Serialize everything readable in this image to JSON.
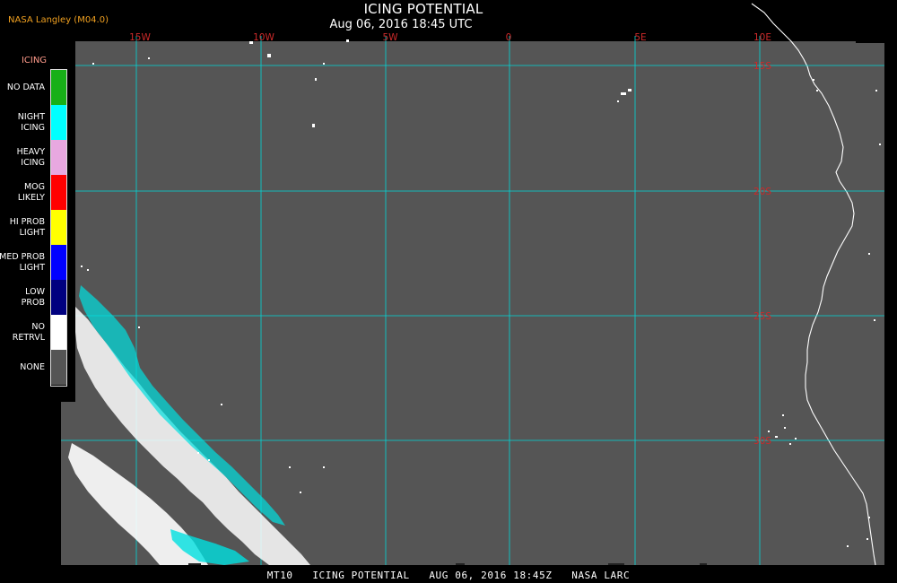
{
  "header": {
    "title": "ICING POTENTIAL",
    "datetime": "Aug 06, 2016 18:45 UTC",
    "provider": "NASA Langley (M04.0)"
  },
  "legend": {
    "title": "ICING",
    "items": [
      {
        "label": "NO DATA",
        "color": "#17b017"
      },
      {
        "label": "NIGHT\nICING",
        "color": "#00ffff"
      },
      {
        "label": "HEAVY\nICING",
        "color": "#e8a8e0"
      },
      {
        "label": "MOG\nLIKELY",
        "color": "#ff0000"
      },
      {
        "label": "HI PROB\nLIGHT",
        "color": "#ffff00"
      },
      {
        "label": "MED PROB\nLIGHT",
        "color": "#0000ff"
      },
      {
        "label": "LOW\nPROB",
        "color": "#00007f"
      },
      {
        "label": "NO\nRETRVL",
        "color": "#ffffff"
      },
      {
        "label": "NONE",
        "color": "#555555"
      }
    ]
  },
  "map": {
    "background_color": "#555555",
    "grid_color": "#00d8d8",
    "lon_labels": [
      "15W",
      "10W",
      "5W",
      "0",
      "5E",
      "10E"
    ],
    "lat_labels": [
      "15S",
      "20S",
      "25S",
      "30S"
    ],
    "coast_color": "#ffffff"
  },
  "footer": {
    "text": "MT10   ICING POTENTIAL   AUG 06, 2016 18:45Z   NASA LARC"
  }
}
